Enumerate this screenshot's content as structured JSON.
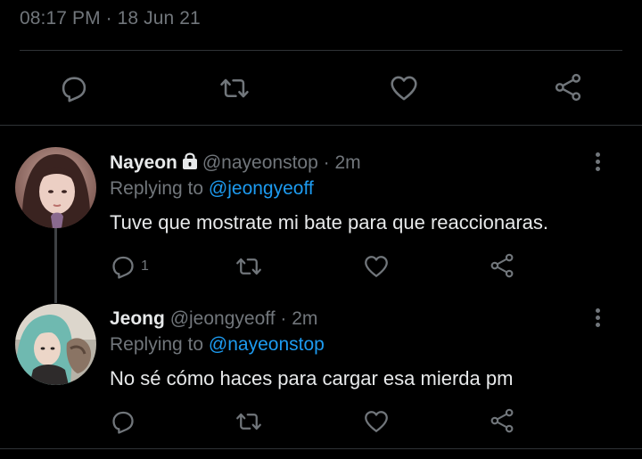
{
  "main_tweet": {
    "timestamp": "08:17 PM · 18 Jun 21"
  },
  "replies": [
    {
      "name": "Nayeon",
      "protected": true,
      "handle": "@nayeonstop",
      "separator": "·",
      "time": "2m",
      "replying_prefix": "Replying to",
      "replying_to": "@jeongyeoff",
      "text": "Tuve que mostrate mi bate para que reaccionaras.",
      "reply_count": "1"
    },
    {
      "name": "Jeong",
      "protected": false,
      "handle": "@jeongyeoff",
      "separator": "·",
      "time": "2m",
      "replying_prefix": "Replying to",
      "replying_to": "@nayeonstop",
      "text": "No sé cómo haces para cargar esa mierda pm",
      "reply_count": ""
    }
  ],
  "icons": {
    "reply": "reply-icon",
    "retweet": "retweet-icon",
    "like": "like-icon",
    "share": "share-icon",
    "more": "more-options-icon",
    "lock": "lock-icon"
  },
  "colors": {
    "background": "#000000",
    "text": "#e7e9ea",
    "muted": "#71767b",
    "link": "#1d9bf0",
    "divider": "#2f3336"
  }
}
